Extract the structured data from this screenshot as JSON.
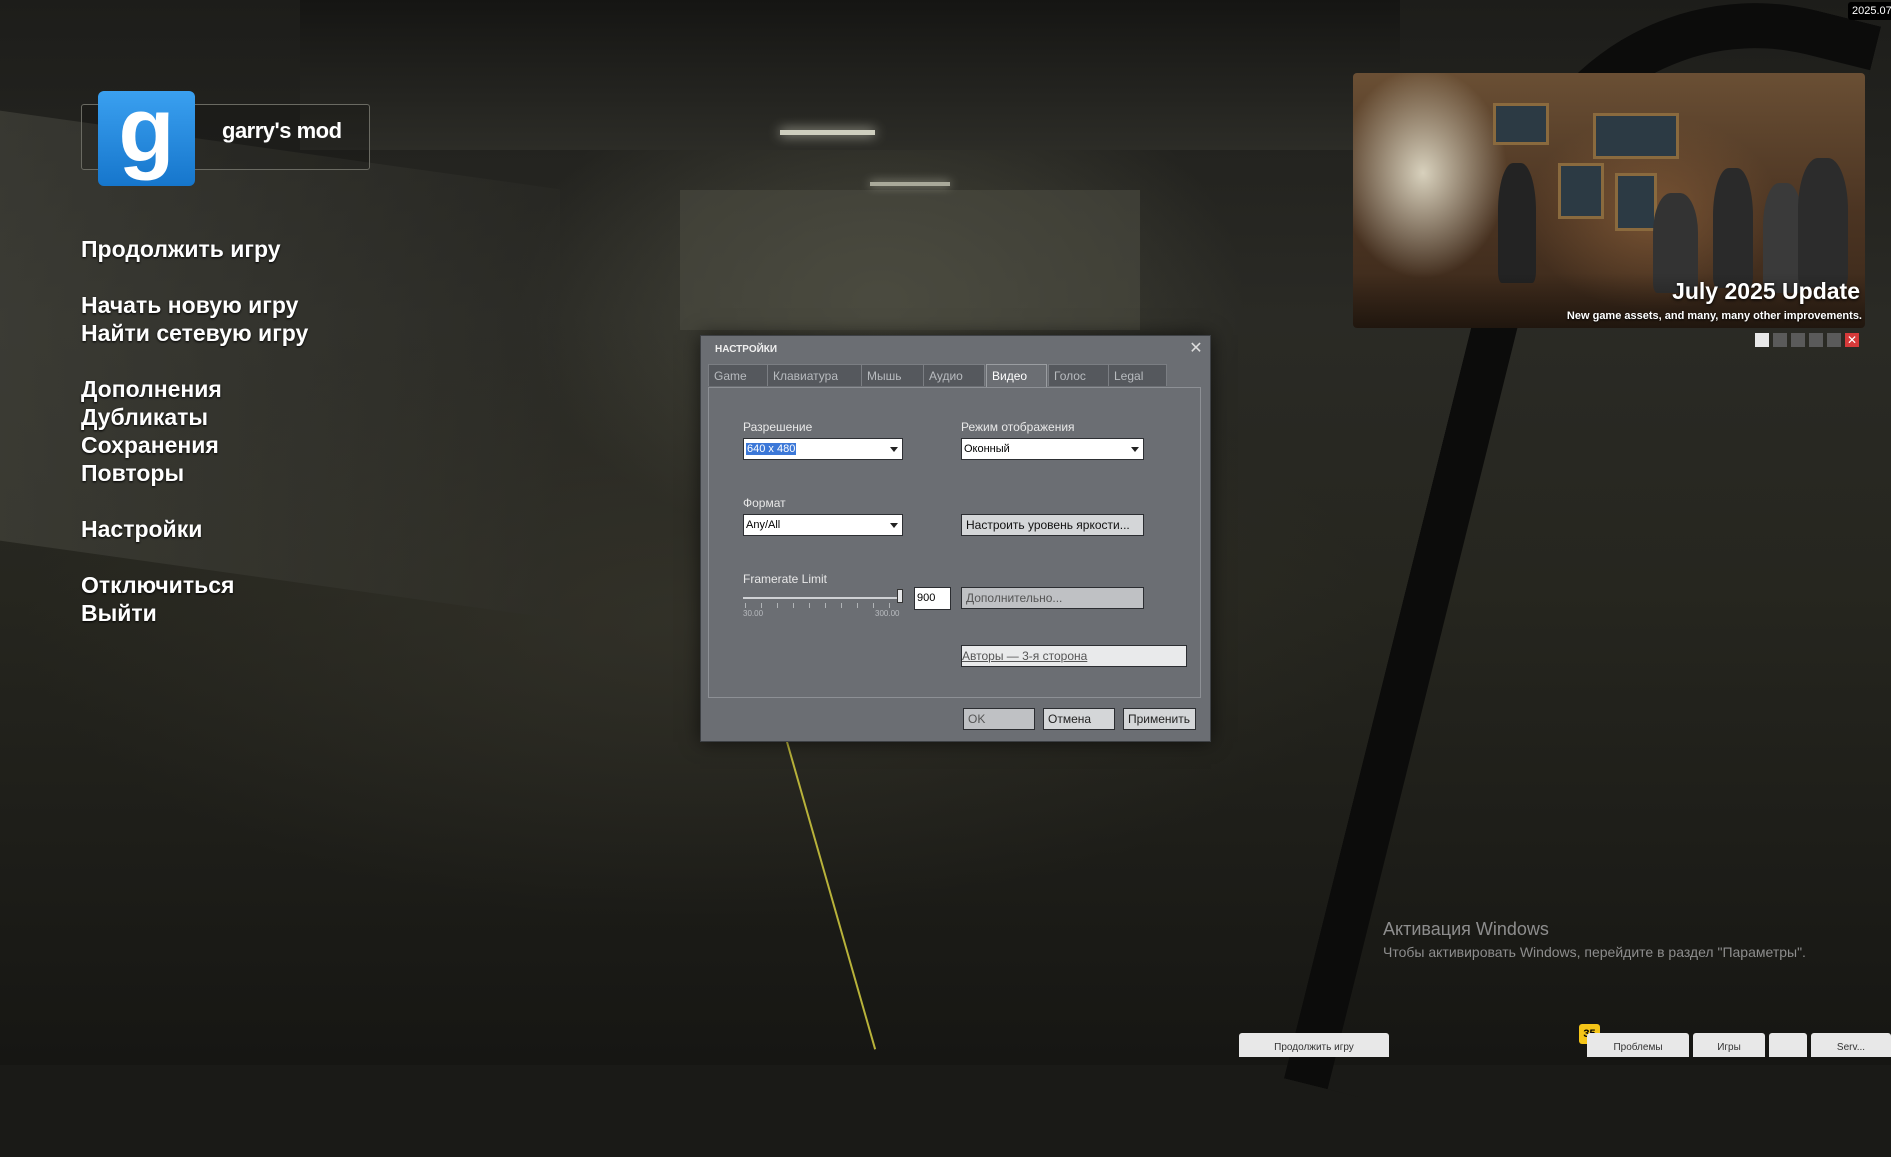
{
  "clock": {
    "text": "2025.07"
  },
  "logo": {
    "glyph": "g",
    "name": "garry's mod"
  },
  "menu": {
    "items": [
      "Продолжить игру",
      "Начать новую игру",
      "Найти сетевую игру",
      "Дополнения",
      "Дубликаты",
      "Сохранения",
      "Повторы",
      "Настройки",
      "Отключиться",
      "Выйти"
    ]
  },
  "news": {
    "title": "July 2025 Update",
    "subtitle": "New game assets, and many, many other improvements.",
    "close_glyph": "✕"
  },
  "watermark": {
    "title": "Активация Windows",
    "subtitle": "Чтобы активировать Windows, перейдите в раздел \"Параметры\"."
  },
  "bottom_bar": {
    "badge": "35",
    "buttons": [
      "Продолжить игру",
      "Проблемы",
      "Игры",
      "",
      "Serv..."
    ]
  },
  "dialog": {
    "title": "Настройки",
    "close_glyph": "✕",
    "tabs": [
      "Game",
      "Клавиатура",
      "Мышь",
      "Аудио",
      "Видео",
      "Голос",
      "Legal"
    ],
    "active_tab": "Видео",
    "resolution": {
      "label": "Разрешение",
      "value": "640 x 480"
    },
    "display_mode": {
      "label": "Режим отображения",
      "value": "Оконный"
    },
    "format": {
      "label": "Формат",
      "value": "Any/All"
    },
    "brightness_button": "Настроить уровень яркости...",
    "framerate": {
      "label": "Framerate Limit",
      "value": "900",
      "min_label": "30.00",
      "max_label": "300.00",
      "position": 0.98
    },
    "advanced_button": "Дополнительно...",
    "credits_button": "Авторы — 3-я сторона",
    "ok": "OK",
    "cancel": "Отмена",
    "apply": "Применить"
  }
}
